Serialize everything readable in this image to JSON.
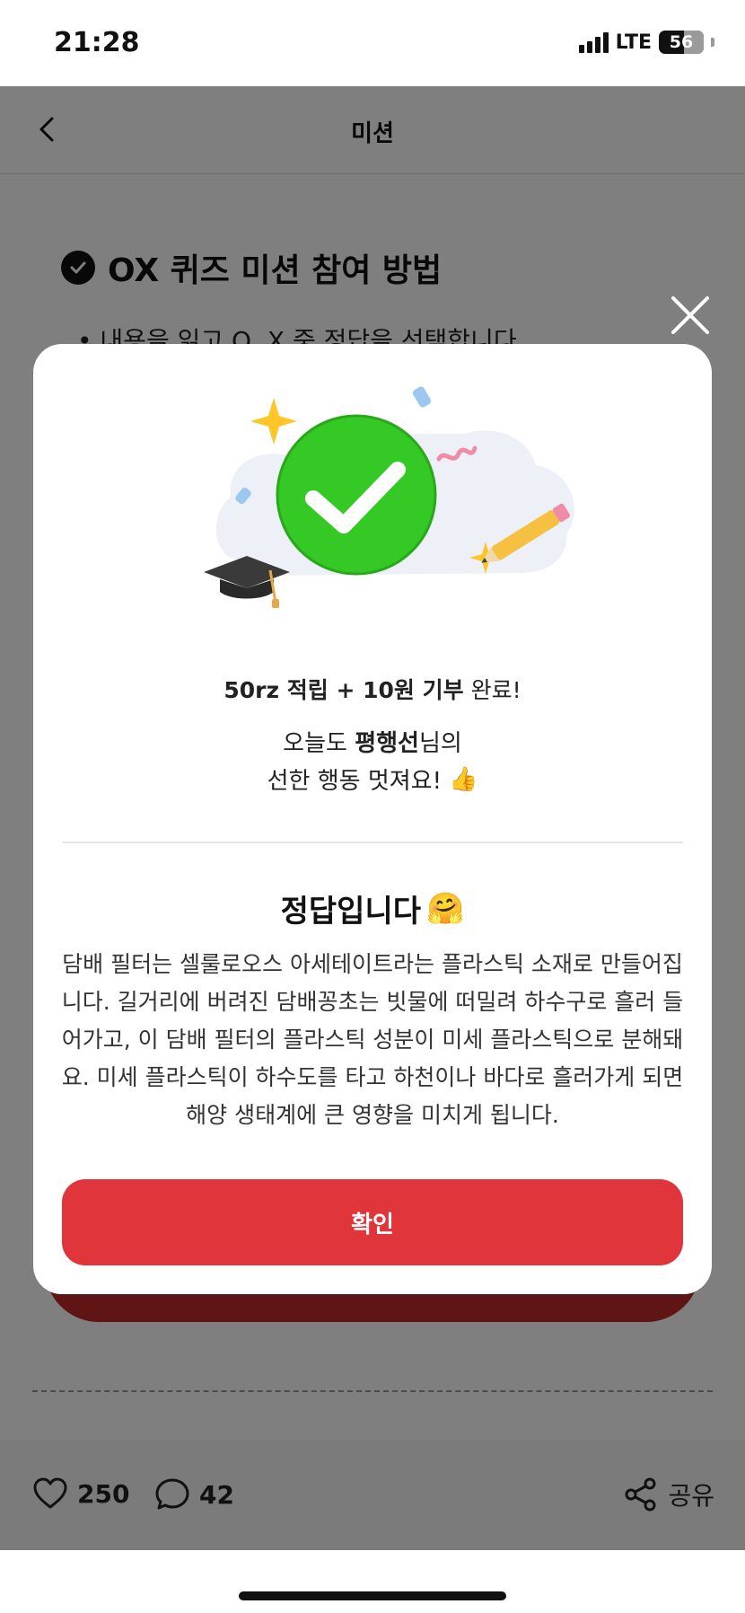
{
  "status_bar": {
    "time": "21:28",
    "network": "LTE",
    "battery": "56"
  },
  "header": {
    "title": "미션"
  },
  "section": {
    "title": "OX 퀴즈 미션 참여 방법",
    "bullet": "내용을 읽고 O, X 중 정답을 선택합니다."
  },
  "footer": {
    "likes": "250",
    "comments": "42",
    "share_label": "공유"
  },
  "modal": {
    "reward_bold": "50rz 적립 + 10원 기부",
    "reward_rest": " 완료!",
    "message_prefix": "오늘도 ",
    "user_name": "평행선",
    "message_suffix": "님의",
    "message_line2": "선한 행동 멋져요!",
    "thumbs_emoji": "👍",
    "answer_title": "정답입니다",
    "hug_emoji": "🤗",
    "explanation": "담배 필터는 셀룰로오스 아세테이트라는 플라스틱 소재로 만들어집니다. 길거리에 버려진 담배꽁초는 빗물에 떠밀려 하수구로 흘러 들어가고, 이 담배 필터의 플라스틱 성분이 미세 플라스틱으로 분해돼요. 미세 플라스틱이 하수도를 타고 하천이나 바다로 흘러가게 되면 해양 생태계에 큰 영향을 미치게 됩니다.",
    "confirm_label": "확인"
  },
  "colors": {
    "accent": "#e0353a",
    "check_green": "#34c924",
    "overlay": "rgba(0,0,0,0.5)"
  },
  "icons": [
    "back-chevron-icon",
    "check-circle-icon",
    "close-icon",
    "heart-icon",
    "comment-icon",
    "share-icon",
    "check-mark-icon",
    "sparkle-icon",
    "graduation-cap-icon",
    "pencil-icon"
  ]
}
